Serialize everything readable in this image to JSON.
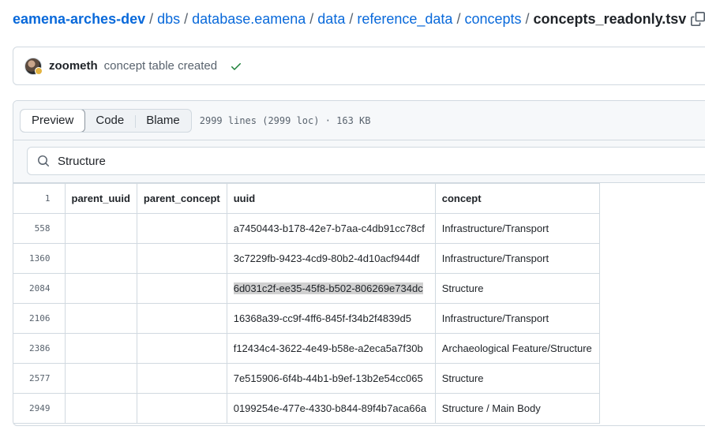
{
  "breadcrumb": {
    "items": [
      "eamena-arches-dev",
      "dbs",
      "database.eamena",
      "data",
      "reference_data",
      "concepts"
    ],
    "separator": "/",
    "file": "concepts_readonly.tsv",
    "copy_icon": "copy-icon"
  },
  "commit": {
    "author": "zoometh",
    "message": "concept table created",
    "status_icon": "check-icon",
    "status_color": "#1a7f37"
  },
  "view_tabs": [
    "Preview",
    "Code",
    "Blame"
  ],
  "active_tab": "Preview",
  "file_meta": "2999 lines (2999 loc) · 163 KB",
  "search": {
    "value": "Structure",
    "icon": "search-icon"
  },
  "table": {
    "header_line": "1",
    "columns": [
      "parent_uuid",
      "parent_concept",
      "uuid",
      "concept"
    ],
    "rows": [
      {
        "line": "558",
        "parent_uuid": "",
        "parent_concept": "",
        "uuid": "a7450443-b178-42e7-b7aa-c4db91cc78cf",
        "concept": "Infrastructure/Transport"
      },
      {
        "line": "1360",
        "parent_uuid": "",
        "parent_concept": "",
        "uuid": "3c7229fb-9423-4cd9-80b2-4d10acf944df",
        "concept": "Infrastructure/Transport"
      },
      {
        "line": "2084",
        "parent_uuid": "",
        "parent_concept": "",
        "uuid": "6d031c2f-ee35-45f8-b502-806269e734dc",
        "concept": "Structure"
      },
      {
        "line": "2106",
        "parent_uuid": "",
        "parent_concept": "",
        "uuid": "16368a39-cc9f-4ff6-845f-f34b2f4839d5",
        "concept": "Infrastructure/Transport"
      },
      {
        "line": "2386",
        "parent_uuid": "",
        "parent_concept": "",
        "uuid": "f12434c4-3622-4e49-b58e-a2eca5a7f30b",
        "concept": "Archaeological Feature/Structure"
      },
      {
        "line": "2577",
        "parent_uuid": "",
        "parent_concept": "",
        "uuid": "7e515906-6f4b-44b1-b9ef-13b2e54cc065",
        "concept": "Structure"
      },
      {
        "line": "2949",
        "parent_uuid": "",
        "parent_concept": "",
        "uuid": "0199254e-477e-4330-b844-89f4b7aca66a",
        "concept": "Structure / Main Body"
      }
    ]
  },
  "colors": {
    "link": "#0969da",
    "border": "#d1d9e0",
    "header_bg": "#f6f8fa",
    "highlight": "#d0d0d0"
  }
}
